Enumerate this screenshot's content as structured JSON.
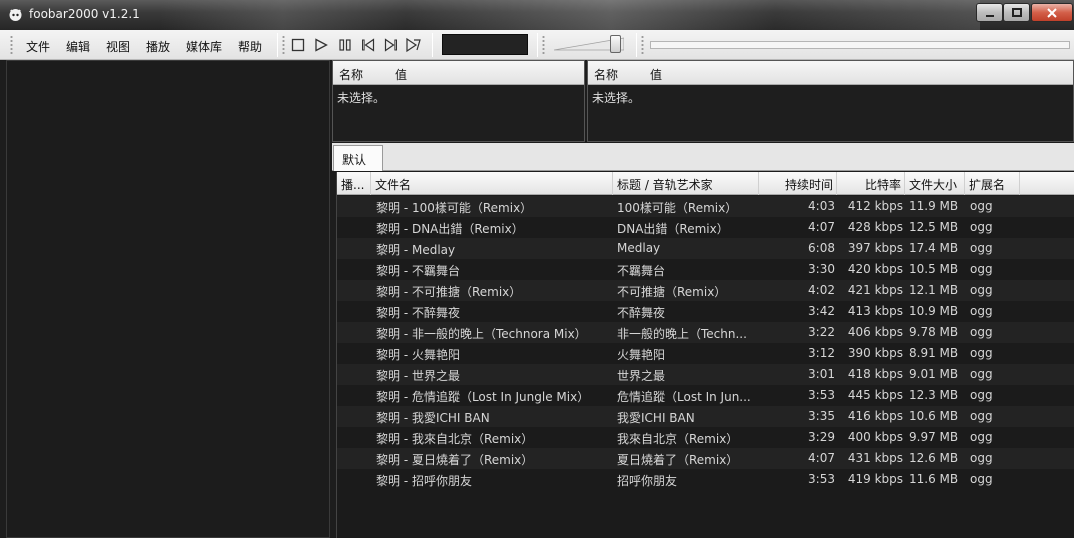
{
  "window": {
    "title": "foobar2000 v1.2.1"
  },
  "menu": [
    "文件",
    "编辑",
    "视图",
    "播放",
    "媒体库",
    "帮助"
  ],
  "properties": [
    {
      "col_name": "名称",
      "col_value": "值",
      "empty_text": "未选择。"
    },
    {
      "col_name": "名称",
      "col_value": "值",
      "empty_text": "未选择。"
    }
  ],
  "tabs": [
    {
      "label": "默认",
      "active": true
    }
  ],
  "playlist": {
    "columns": {
      "playing": "播...",
      "filename": "文件名",
      "title": "标题 / 音轨艺术家",
      "duration": "持续时间",
      "bitrate": "比特率",
      "filesize": "文件大小",
      "extension": "扩展名"
    },
    "rows": [
      {
        "file": "黎明 - 100樣可能（Remix）",
        "title": "100樣可能（Remix）",
        "duration": "4:03",
        "bitrate": "412 kbps",
        "size": "11.9 MB",
        "ext": "ogg"
      },
      {
        "file": "黎明 - DNA出錯（Remix）",
        "title": "DNA出錯（Remix）",
        "duration": "4:07",
        "bitrate": "428 kbps",
        "size": "12.5 MB",
        "ext": "ogg"
      },
      {
        "file": "黎明 - Medlay",
        "title": "Medlay",
        "duration": "6:08",
        "bitrate": "397 kbps",
        "size": "17.4 MB",
        "ext": "ogg"
      },
      {
        "file": "黎明 - 不羈舞台",
        "title": "不羈舞台",
        "duration": "3:30",
        "bitrate": "420 kbps",
        "size": "10.5 MB",
        "ext": "ogg"
      },
      {
        "file": "黎明 - 不可推搪（Remix）",
        "title": "不可推搪（Remix）",
        "duration": "4:02",
        "bitrate": "421 kbps",
        "size": "12.1 MB",
        "ext": "ogg"
      },
      {
        "file": "黎明 - 不醉舞夜",
        "title": "不醉舞夜",
        "duration": "3:42",
        "bitrate": "413 kbps",
        "size": "10.9 MB",
        "ext": "ogg"
      },
      {
        "file": "黎明 - 非一般的晚上（Technora Mix）",
        "title": "非一般的晚上（Techn...",
        "duration": "3:22",
        "bitrate": "406 kbps",
        "size": "9.78 MB",
        "ext": "ogg"
      },
      {
        "file": "黎明 - 火舞艳阳",
        "title": "火舞艳阳",
        "duration": "3:12",
        "bitrate": "390 kbps",
        "size": "8.91 MB",
        "ext": "ogg"
      },
      {
        "file": "黎明 - 世界之最",
        "title": "世界之最",
        "duration": "3:01",
        "bitrate": "418 kbps",
        "size": "9.01 MB",
        "ext": "ogg"
      },
      {
        "file": "黎明 - 危情追蹤（Lost In Jungle Mix）",
        "title": "危情追蹤（Lost In Jun...",
        "duration": "3:53",
        "bitrate": "445 kbps",
        "size": "12.3 MB",
        "ext": "ogg"
      },
      {
        "file": "黎明 - 我愛ICHI BAN",
        "title": "我愛ICHI BAN",
        "duration": "3:35",
        "bitrate": "416 kbps",
        "size": "10.6 MB",
        "ext": "ogg"
      },
      {
        "file": "黎明 - 我來自北京（Remix）",
        "title": "我來自北京（Remix）",
        "duration": "3:29",
        "bitrate": "400 kbps",
        "size": "9.97 MB",
        "ext": "ogg"
      },
      {
        "file": "黎明 - 夏日燒着了（Remix）",
        "title": "夏日燒着了（Remix）",
        "duration": "4:07",
        "bitrate": "431 kbps",
        "size": "12.6 MB",
        "ext": "ogg"
      },
      {
        "file": "黎明 - 招呼你朋友",
        "title": "招呼你朋友",
        "duration": "3:53",
        "bitrate": "419 kbps",
        "size": "11.6 MB",
        "ext": "ogg"
      }
    ]
  },
  "volume": {
    "level": 0.85
  },
  "colors": {
    "panel_bg": "#1b1b1b",
    "row_alt": "#232323",
    "text": "#d6d6d6",
    "close_button": "#c0402a"
  }
}
